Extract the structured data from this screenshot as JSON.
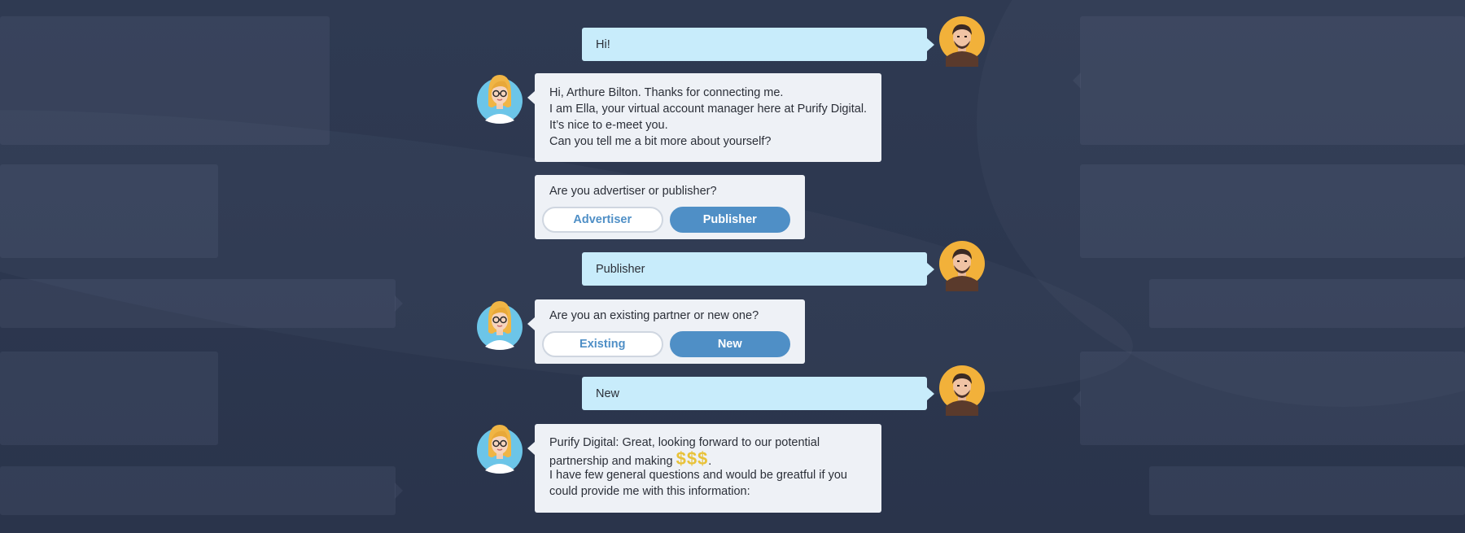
{
  "conversation": {
    "user_name": "Arthure Bilton",
    "bot_name": "Ella",
    "company": "Purify Digital",
    "messages": [
      {
        "from": "user",
        "text": "Hi!"
      },
      {
        "from": "bot",
        "lines": [
          "Hi, Arthure Bilton. Thanks for connecting me.",
          "I am Ella, your virtual account manager here at Purify Digital.",
          "It’s nice to e-meet you.",
          "Can you tell me a bit more about yourself?"
        ]
      },
      {
        "from": "bot",
        "question": "Are you advertiser or publisher?",
        "options": [
          "Advertiser",
          "Publisher"
        ],
        "selected": "Publisher"
      },
      {
        "from": "user",
        "text": "Publisher"
      },
      {
        "from": "bot",
        "question": "Are you an existing partner or new one?",
        "options": [
          "Existing",
          "New"
        ],
        "selected": "New"
      },
      {
        "from": "user",
        "text": "New"
      },
      {
        "from": "bot",
        "lines": [
          "Purify Digital: Great, looking forward to our potential",
          "partnership and making",
          "$$$",
          ".",
          "I have few general questions and would be greatful if you",
          "could provide me with this information:"
        ]
      }
    ]
  },
  "colors": {
    "background": "#2f3a52",
    "user_bubble": "#c8ecfb",
    "bot_bubble": "#eef1f6",
    "accent": "#4f8fc6",
    "money": "#e8c23a"
  },
  "icons": {
    "user_avatar": "man-avatar-icon",
    "bot_avatar": "woman-assistant-avatar-icon"
  }
}
